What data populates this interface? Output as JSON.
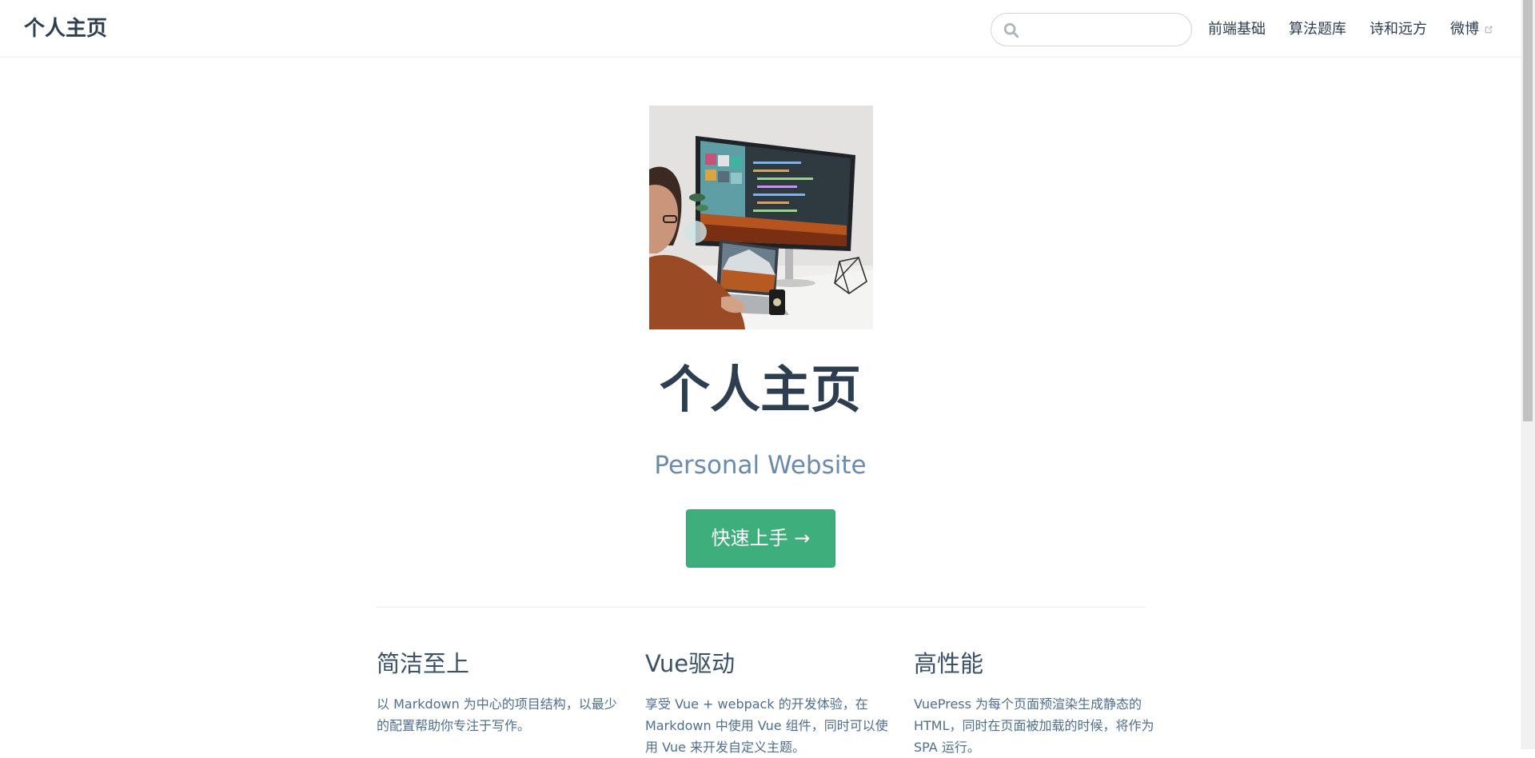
{
  "navbar": {
    "site_name": "个人主页",
    "search": {
      "value": "",
      "placeholder": ""
    },
    "links": [
      {
        "label": "前端基础",
        "icon": null
      },
      {
        "label": "算法题库",
        "icon": null
      },
      {
        "label": "诗和远方",
        "icon": null
      },
      {
        "label": "微博",
        "icon": "external-link-icon"
      }
    ]
  },
  "hero": {
    "image": "hero-image",
    "title": "个人主页",
    "description": "Personal Website",
    "action_label": "快速上手 →"
  },
  "features": [
    {
      "title": "简洁至上",
      "details": "以 Markdown 为中心的项目结构，以最少的配置帮助你专注于写作。"
    },
    {
      "title": "Vue驱动",
      "details": "享受 Vue + webpack 的开发体验，在 Markdown 中使用 Vue 组件，同时可以使用 Vue 来开发自定义主题。"
    },
    {
      "title": "高性能",
      "details": "VuePress 为每个页面预渲染生成静态的 HTML，同时在页面被加载的时候，将作为 SPA 运行。"
    }
  ],
  "colors": {
    "accent": "#3eaf7c",
    "text": "#2c3e50",
    "description": "#6a8bad",
    "border": "#eaecef"
  }
}
